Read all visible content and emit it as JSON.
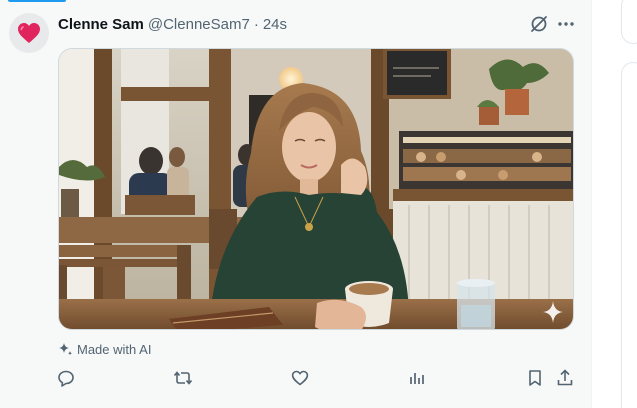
{
  "tweet": {
    "author_name": "Clenne Sam",
    "author_handle": "@ClenneSam7",
    "separator": "·",
    "timestamp": "24s",
    "avatar_icon": "heart-emoji-icon",
    "ai_label": "Made with AI",
    "media_description_icon": "photo-woman-in-cafe"
  },
  "icons": {
    "grok": "grok-slash-icon",
    "more": "more-horizontal-icon",
    "sparkle": "sparkle-icon",
    "reply": "reply-icon",
    "retweet": "retweet-icon",
    "like": "heart-outline-icon",
    "views": "views-chart-icon",
    "bookmark": "bookmark-icon",
    "share": "share-icon"
  },
  "colors": {
    "accent": "#1d9bf0",
    "text_primary": "#0f1419",
    "text_secondary": "#536471",
    "heart_red": "#e0245e"
  }
}
